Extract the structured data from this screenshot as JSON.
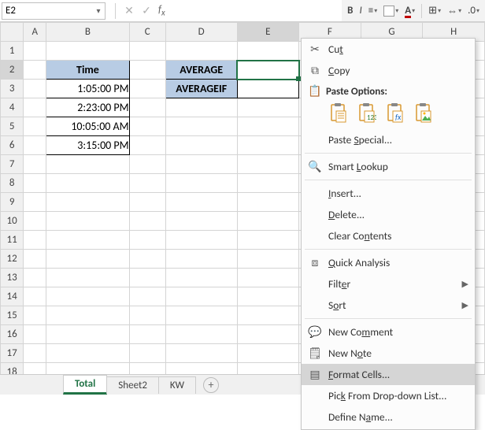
{
  "namebox": {
    "value": "E2"
  },
  "ribbon": {
    "bold": "B",
    "italic": "I",
    "fontcolor_letter": "A"
  },
  "columns": [
    "A",
    "B",
    "C",
    "D",
    "E",
    "F",
    "G",
    "H"
  ],
  "row_count": 18,
  "selected": {
    "col": "E",
    "row": 2
  },
  "time_table": {
    "header": "Time",
    "values": [
      "1:05:00 PM",
      "2:23:00 PM",
      "10:05:00 AM",
      "3:15:00 PM"
    ]
  },
  "avg_table": {
    "labels": [
      "AVERAGE",
      "AVERAGEIF"
    ],
    "values": [
      "",
      ""
    ]
  },
  "tabs": {
    "items": [
      "Total",
      "Sheet2",
      "KW"
    ],
    "active_index": 0
  },
  "context_menu": {
    "cut": "Cut",
    "copy": "Copy",
    "paste_options_header": "Paste Options:",
    "paste_special": "Paste Special...",
    "smart_lookup": "Smart Lookup",
    "insert": "Insert...",
    "delete": "Delete...",
    "clear_contents": "Clear Contents",
    "quick_analysis": "Quick Analysis",
    "filter": "Filter",
    "sort": "Sort",
    "new_comment": "New Comment",
    "new_note": "New Note",
    "format_cells": "Format Cells...",
    "pick_from_list": "Pick From Drop-down List...",
    "define_name": "Define Name...",
    "hovered": "format_cells"
  }
}
